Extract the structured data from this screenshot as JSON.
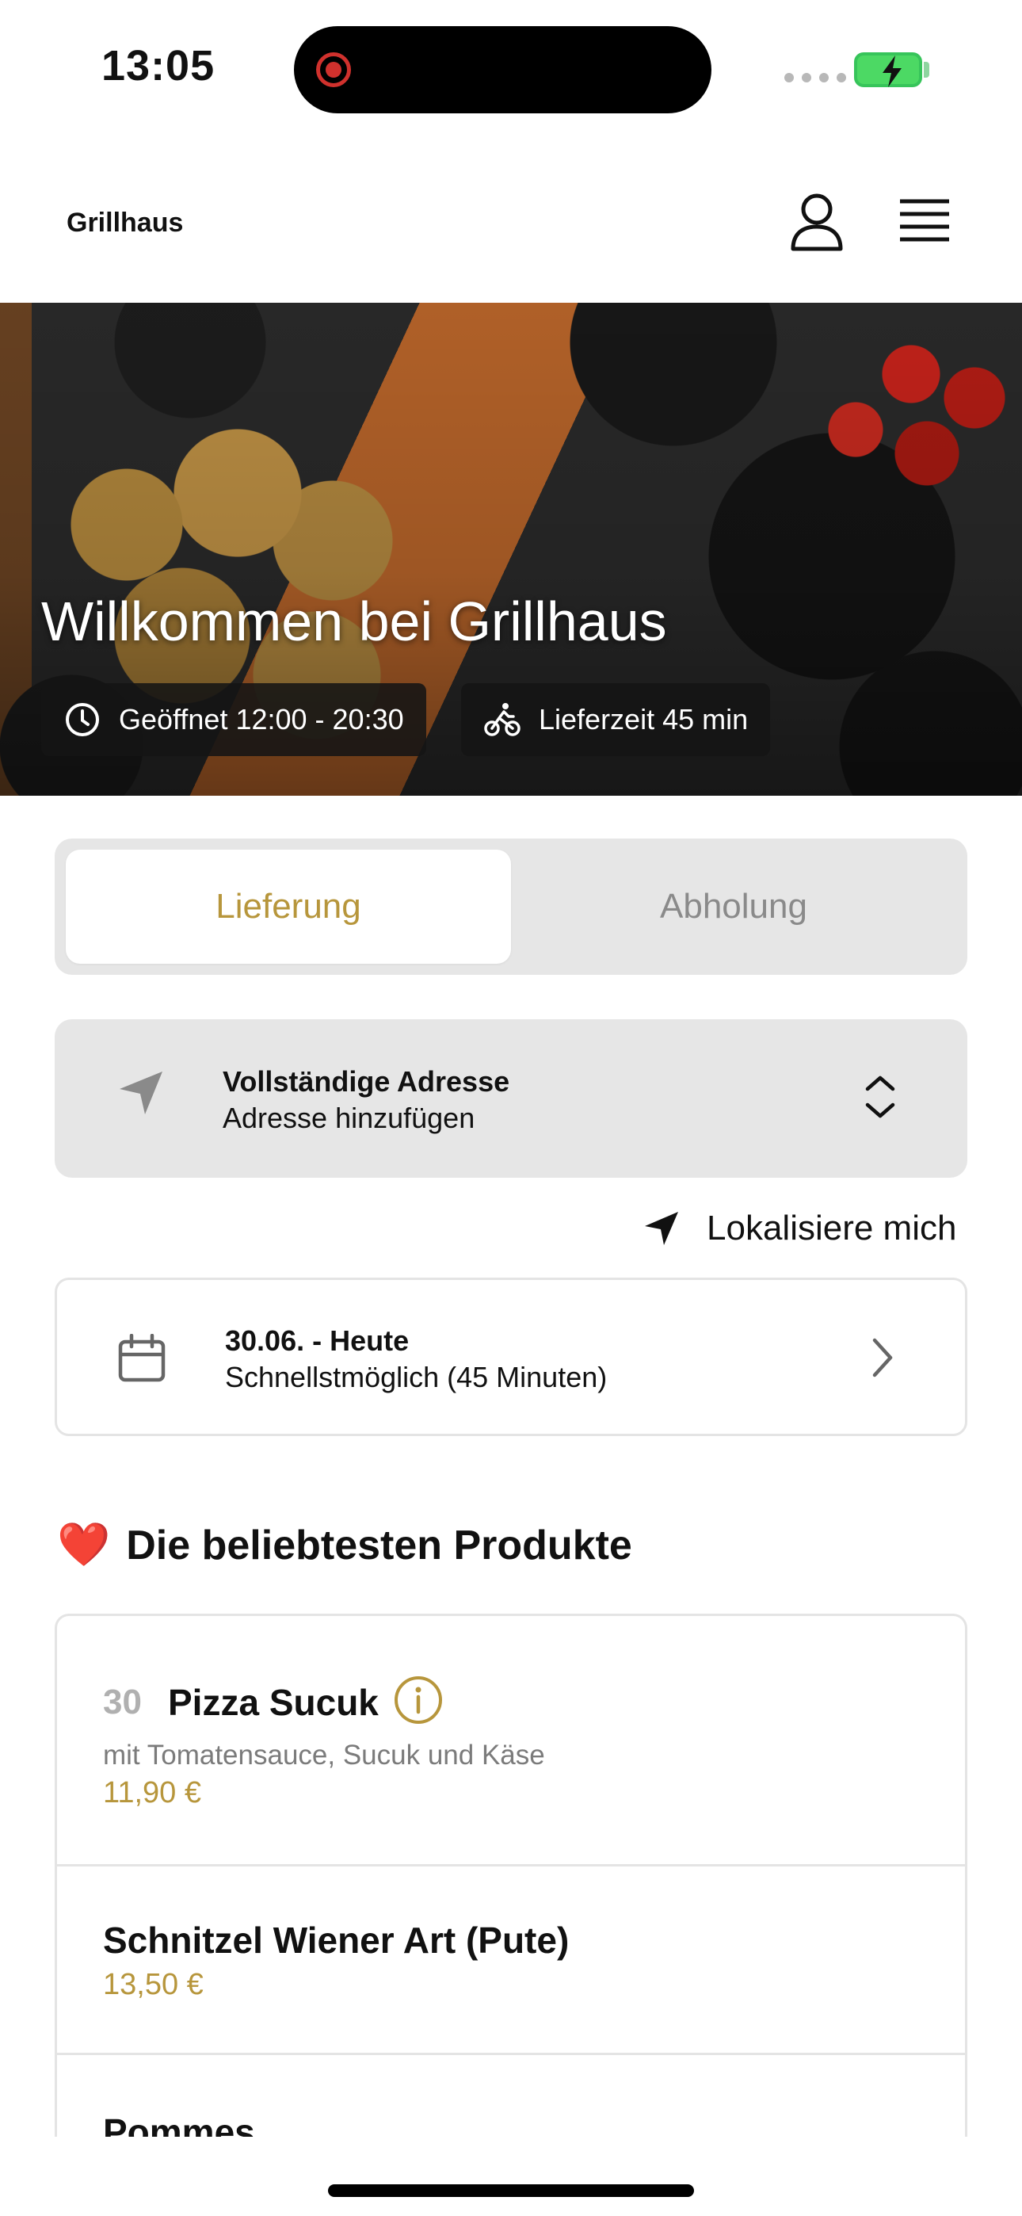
{
  "status_bar": {
    "time": "13:05"
  },
  "header": {
    "brand": "Grillhaus"
  },
  "hero": {
    "title": "Willkommen bei Grillhaus",
    "opening_hours": "Geöffnet 12:00 - 20:30",
    "delivery_time": "Lieferzeit 45 min"
  },
  "mode_toggle": {
    "delivery": "Lieferung",
    "pickup": "Abholung",
    "selected": "Lieferung"
  },
  "address": {
    "title": "Vollständige Adresse",
    "subtitle": "Adresse hinzufügen"
  },
  "locate": {
    "label": "Lokalisiere mich"
  },
  "schedule": {
    "title": "30.06. - Heute",
    "subtitle": "Schnellstmöglich (45 Minuten)"
  },
  "popular": {
    "emoji": "❤️",
    "title": "Die beliebtesten Produkte",
    "products": [
      {
        "number": "30",
        "name": "Pizza Sucuk",
        "description": "mit Tomatensauce, Sucuk und Käse",
        "price": "11,90 €"
      },
      {
        "name": "Schnitzel Wiener Art (Pute)",
        "price": "13,50 €"
      },
      {
        "name": "Pommes"
      }
    ]
  },
  "colors": {
    "accent": "#b7963c",
    "card_gray": "#e6e6e6",
    "battery": "#4cd964",
    "record": "#d0312d"
  }
}
